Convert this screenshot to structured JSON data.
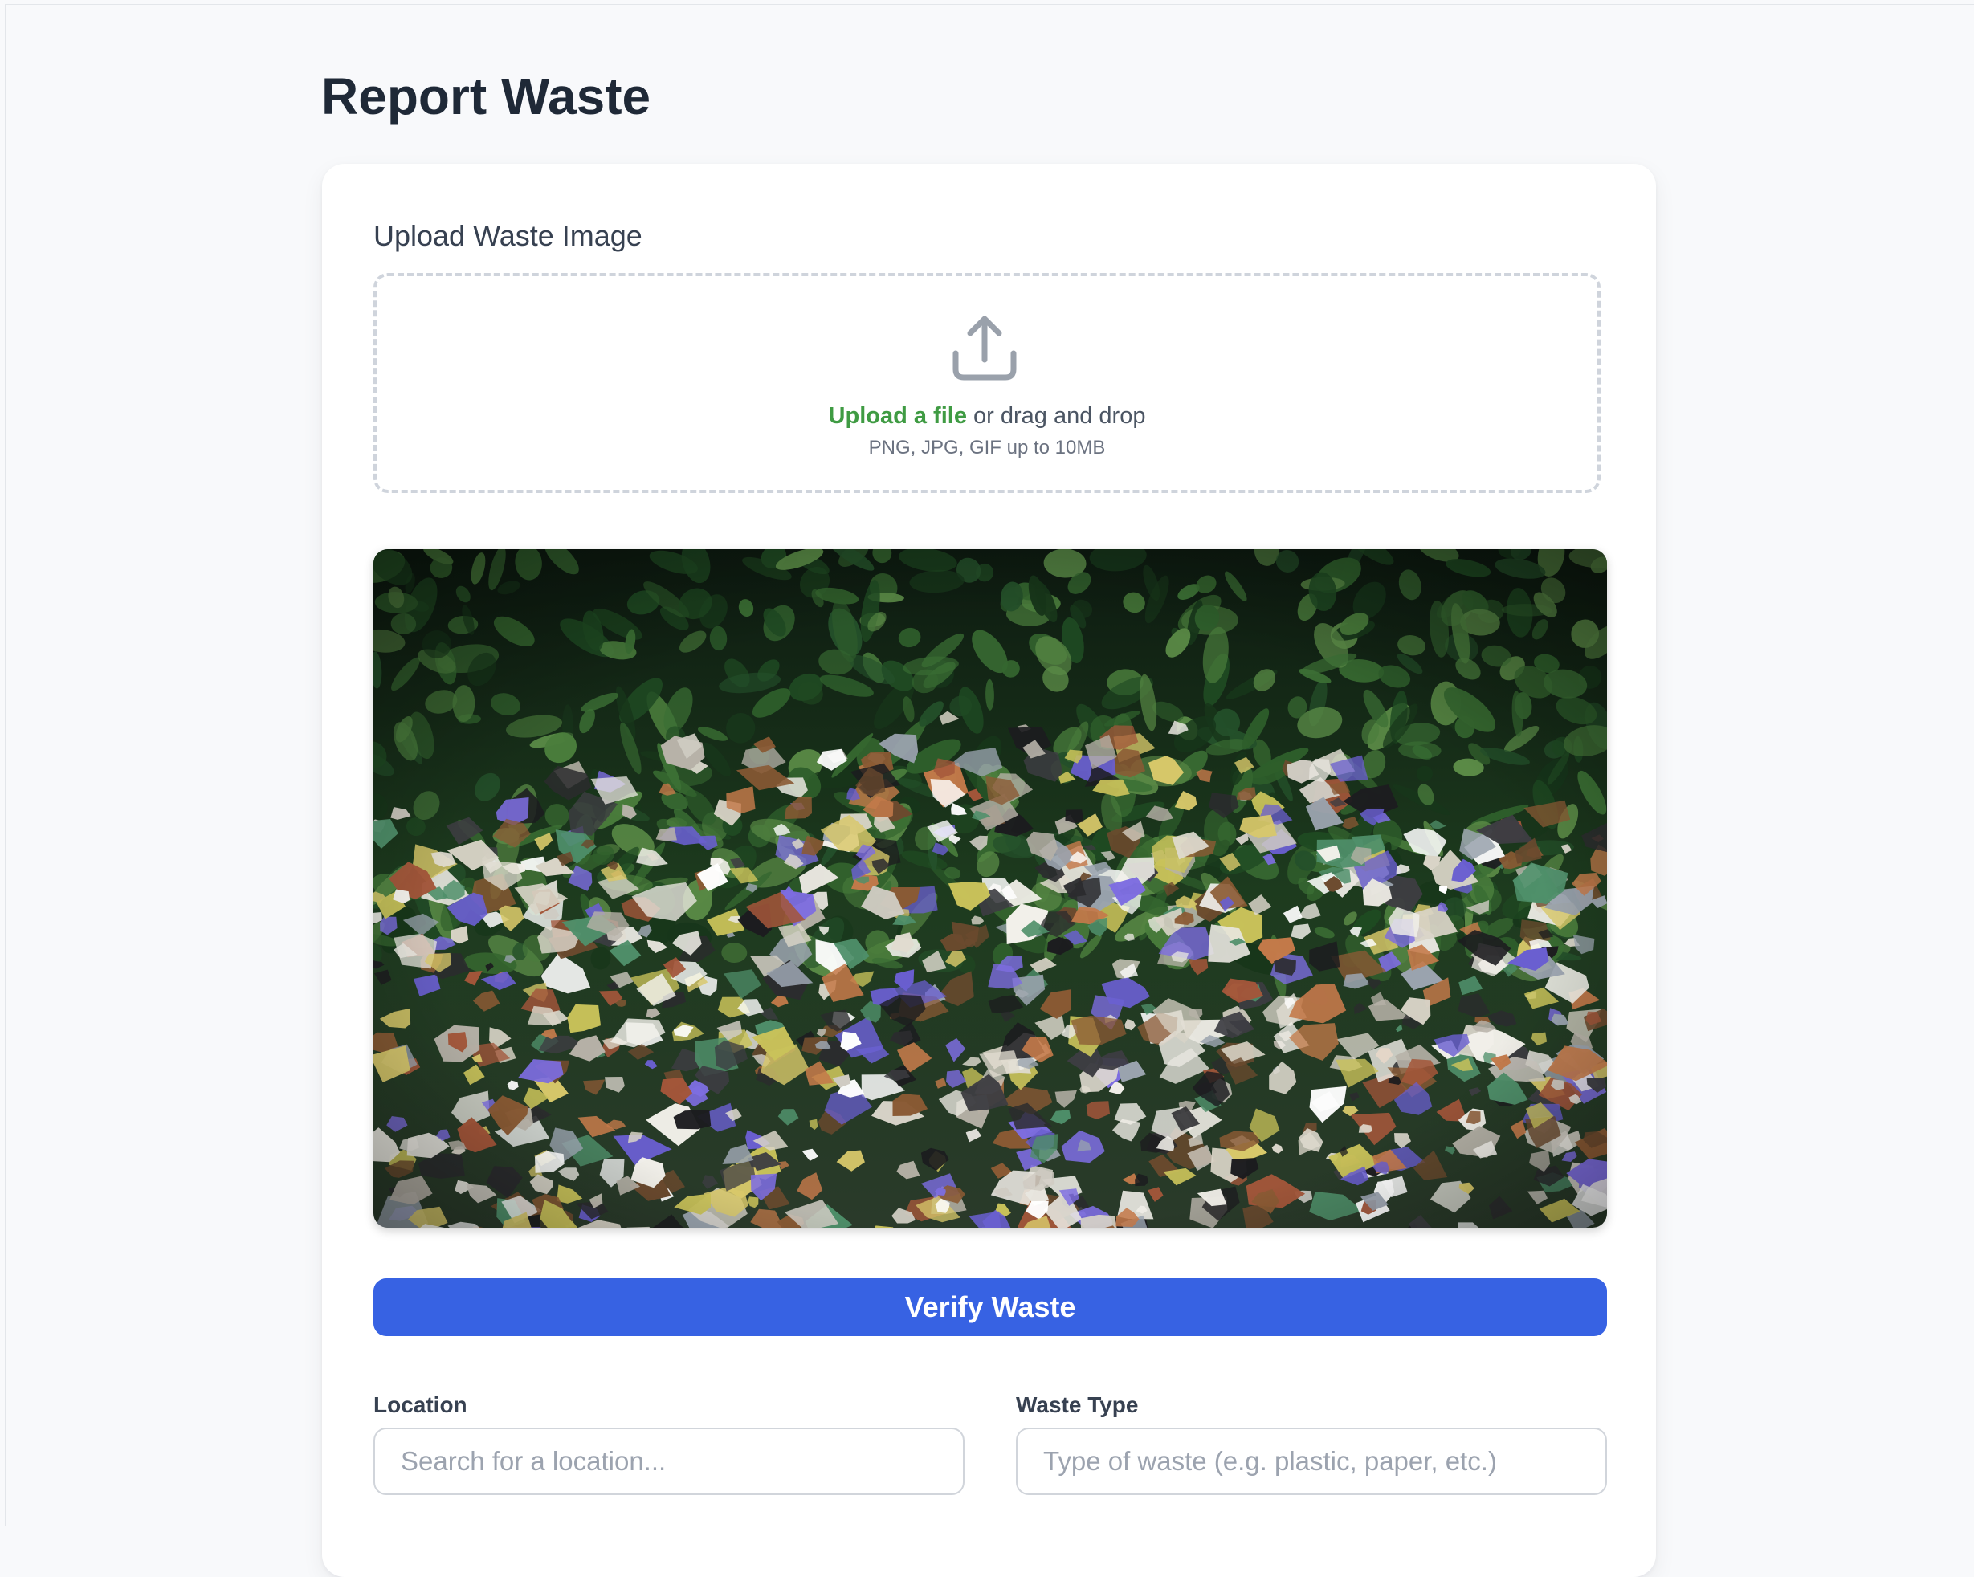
{
  "page": {
    "title": "Report Waste"
  },
  "upload": {
    "label": "Upload Waste Image",
    "icon": "upload-icon",
    "link_text": "Upload a file",
    "rest_text": " or drag and drop",
    "hint": "PNG, JPG, GIF up to 10MB"
  },
  "preview": {
    "icon": "waste-photo"
  },
  "verify": {
    "label": "Verify Waste"
  },
  "form": {
    "location": {
      "label": "Location",
      "placeholder": "Search for a location..."
    },
    "waste_type": {
      "label": "Waste Type",
      "placeholder": "Type of waste (e.g. plastic, paper, etc.)"
    }
  },
  "colors": {
    "accent_link": "#3f9b43",
    "primary_button": "#3762e3",
    "background": "#f8f9fb"
  }
}
